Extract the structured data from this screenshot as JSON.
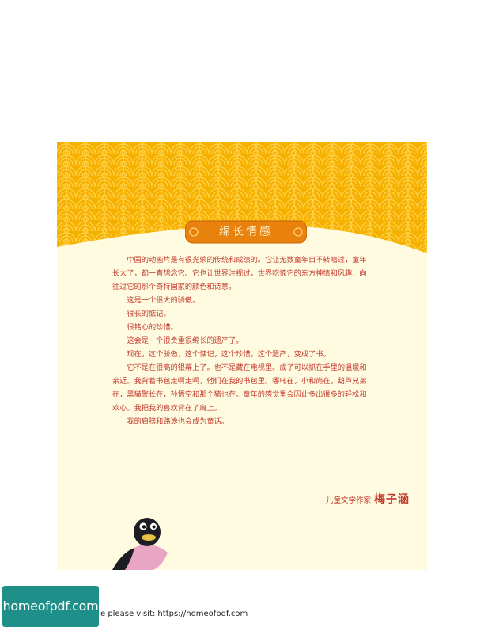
{
  "page": {
    "title": "绵长情感",
    "paragraphs": [
      "中国的动画片是有很光荣的传统和成绩的。它让无数童年目不转睛过，童年长大了，都一直想念它。它也让世界注视过，世界吃惊它的东方神情和风趣，向往过它的那个奇特国家的颜色和诗意。",
      "这是一个很大的骄傲。",
      "很长的惦记。",
      "很铭心的珍惜。",
      "这会是一个很贵重很绵长的遗产了。",
      "现在，这个骄傲，这个惦记，这个珍惜，这个遗产，变成了书。",
      "它不是在很高的银幕上了。也不是藏在电视里。成了可以抓在手里的温暖和亲近。我背着书包走啊走啊，他们在我的书包里。哪吒在，小和尚在，葫芦兄弟在，黑猫警长在，孙悟空和那个猪也在。童年的感觉里会因此多出很多的轻松和欢心。我把我的喜欢背在了肩上。",
      "我的肩膀和路途也会成为童话。"
    ],
    "signature_role": "儿童文学作家",
    "signature_name": "梅子涵"
  },
  "watermark": {
    "badge": "homeofpdf.com",
    "visit_text": "e please visit: https://homeofpdf.com"
  },
  "colors": {
    "header_orange": "#f6b000",
    "banner_orange": "#e8820c",
    "text_red": "#c23a2e",
    "paper": "#fffbe0",
    "badge_teal": "#1f8f8a"
  }
}
